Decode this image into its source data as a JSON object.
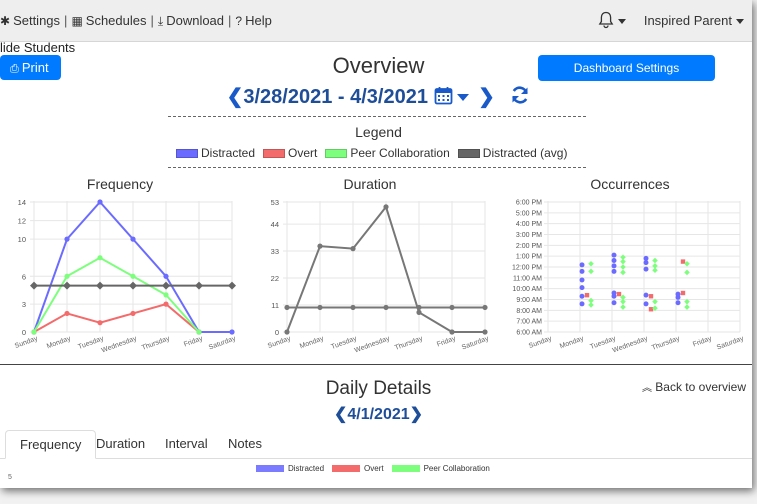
{
  "navbar": {
    "settings": "Settings",
    "schedules": "Schedules",
    "download": "Download",
    "help": "Help",
    "sep": "|",
    "user": "Inspired Parent"
  },
  "toolbar": {
    "hide_students": "lide Students",
    "print": "Print",
    "title": "Overview",
    "dashboard_settings": "Dashboard Settings",
    "date_range": "3/28/2021 - 4/3/2021"
  },
  "legend": {
    "title": "Legend",
    "items": [
      {
        "label": "Distracted",
        "color": "#6b6bff"
      },
      {
        "label": "Overt",
        "color": "#f36b6b"
      },
      {
        "label": "Peer Collaboration",
        "color": "#7dff7d"
      },
      {
        "label": "Distracted (avg)",
        "color": "#666666"
      }
    ]
  },
  "chart_data": [
    {
      "type": "line",
      "title": "Frequency",
      "categories": [
        "Sunday",
        "Monday",
        "Tuesday",
        "Wednesday",
        "Thursday",
        "Friday",
        "Saturday"
      ],
      "yticks": [
        0,
        3,
        6,
        10,
        12,
        14
      ],
      "ylim": [
        0,
        14
      ],
      "series": [
        {
          "name": "Distracted",
          "color": "#6b6bff",
          "values": [
            0,
            10,
            14,
            10,
            6,
            0,
            0
          ]
        },
        {
          "name": "Overt",
          "color": "#f36b6b",
          "values": [
            0,
            2,
            1,
            2,
            3,
            0,
            null
          ]
        },
        {
          "name": "Peer Collaboration",
          "color": "#7dff7d",
          "values": [
            0,
            6,
            8,
            6,
            4,
            0,
            null
          ]
        },
        {
          "name": "Distracted (avg)",
          "color": "#666666",
          "values": [
            5,
            5,
            5,
            5,
            5,
            5,
            5
          ],
          "marker": "diamond"
        }
      ]
    },
    {
      "type": "line",
      "title": "Duration",
      "categories": [
        "Sunday",
        "Monday",
        "Tuesday",
        "Wednesday",
        "Thursday",
        "Friday",
        "Saturday"
      ],
      "yticks": [
        0,
        11,
        22,
        33,
        44,
        53
      ],
      "ylim": [
        0,
        53
      ],
      "series": [
        {
          "name": "Distracted",
          "color": "#777777",
          "values": [
            0,
            35,
            34,
            51,
            8,
            0,
            0
          ]
        },
        {
          "name": "Distracted (avg)",
          "color": "#777777",
          "values": [
            10,
            10,
            10,
            10,
            10,
            10,
            10
          ]
        }
      ]
    },
    {
      "type": "scatter",
      "title": "Occurrences",
      "categories": [
        "Sunday",
        "Monday",
        "Tuesday",
        "Wednesday",
        "Thursday",
        "Friday",
        "Saturday"
      ],
      "yticks": [
        "6:00 PM",
        "5:00 PM",
        "4:00 PM",
        "3:00 PM",
        "2:00 PM",
        "1:00 PM",
        "12:00 PM",
        "11:00 AM",
        "10:00 AM",
        "9:00 AM",
        "8:00 AM",
        "7:00 AM",
        "6:00 AM"
      ],
      "yrange_hours": [
        6,
        18
      ],
      "series": [
        {
          "name": "Distracted",
          "color": "#6b6bff",
          "points": [
            [
              1,
              8.6
            ],
            [
              1,
              9.3
            ],
            [
              1,
              10.1
            ],
            [
              1,
              10.8
            ],
            [
              1,
              11.6
            ],
            [
              1,
              12.2
            ],
            [
              2,
              8.7
            ],
            [
              2,
              9.3
            ],
            [
              2,
              9.6
            ],
            [
              2,
              11.6
            ],
            [
              2,
              12.1
            ],
            [
              2,
              12.6
            ],
            [
              2,
              13.1
            ],
            [
              3,
              8.6
            ],
            [
              3,
              9.4
            ],
            [
              3,
              11.8
            ],
            [
              3,
              12.4
            ],
            [
              3,
              12.8
            ],
            [
              4,
              8.7
            ],
            [
              4,
              9.2
            ],
            [
              4,
              9.5
            ]
          ]
        },
        {
          "name": "Overt",
          "color": "#f36b6b",
          "points": [
            [
              1,
              9.4
            ],
            [
              2,
              9.5
            ],
            [
              3,
              9.3
            ],
            [
              3,
              8.1
            ],
            [
              4,
              9.6
            ],
            [
              4,
              12.5
            ]
          ]
        },
        {
          "name": "Peer Collaboration",
          "color": "#7dff7d",
          "points": [
            [
              1,
              8.5
            ],
            [
              1,
              8.9
            ],
            [
              1,
              11.6
            ],
            [
              1,
              12.3
            ],
            [
              2,
              8.3
            ],
            [
              2,
              8.8
            ],
            [
              2,
              9.2
            ],
            [
              2,
              11.5
            ],
            [
              2,
              12.0
            ],
            [
              2,
              12.5
            ],
            [
              2,
              12.9
            ],
            [
              3,
              8.2
            ],
            [
              3,
              8.8
            ],
            [
              3,
              11.7
            ],
            [
              3,
              12.1
            ],
            [
              3,
              12.6
            ],
            [
              4,
              8.3
            ],
            [
              4,
              8.8
            ],
            [
              4,
              11.5
            ],
            [
              4,
              12.3
            ]
          ]
        }
      ]
    }
  ],
  "daily": {
    "title": "Daily Details",
    "back": "Back to overview",
    "date": "4/1/2021",
    "tabs": [
      "Frequency",
      "Duration",
      "Interval",
      "Notes"
    ],
    "legend": [
      {
        "label": "Distracted",
        "color": "#7b7bff"
      },
      {
        "label": "Overt",
        "color": "#f36b6b"
      },
      {
        "label": "Peer Collaboration",
        "color": "#7dff7d"
      }
    ],
    "axis_top": "5"
  }
}
